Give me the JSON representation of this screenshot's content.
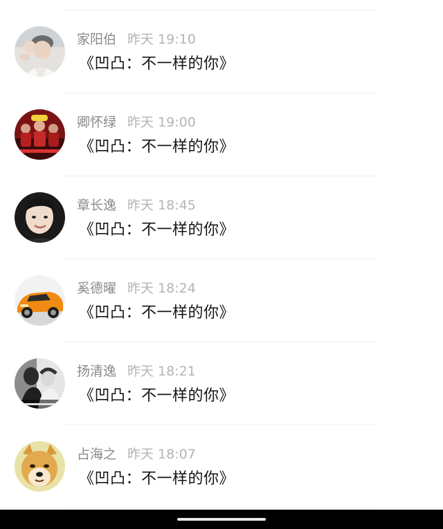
{
  "messages": [
    {
      "name": "家阳伯",
      "time": "昨天 19:10",
      "text": "《凹凸：不一样的你》",
      "avatar_icon": "young-man-photo"
    },
    {
      "name": "卿怀绿",
      "time": "昨天 19:00",
      "text": "《凹凸：不一样的你》",
      "avatar_icon": "group-poster"
    },
    {
      "name": "章长逸",
      "time": "昨天 18:45",
      "text": "《凹凸：不一样的你》",
      "avatar_icon": "smiling-boy-photo"
    },
    {
      "name": "奚德曜",
      "time": "昨天 18:24",
      "text": "《凹凸：不一样的你》",
      "avatar_icon": "orange-sports-car"
    },
    {
      "name": "扬清逸",
      "time": "昨天 18:21",
      "text": "《凹凸：不一样的你》",
      "avatar_icon": "couple-photo"
    },
    {
      "name": "占海之",
      "time": "昨天 18:07",
      "text": "《凹凸：不一样的你》",
      "avatar_icon": "doge-dog"
    }
  ],
  "colors": {
    "name": "#8a8a8a",
    "time": "#b4b4b4",
    "message": "#141414",
    "divider": "#efefef",
    "navbar": "#000000"
  }
}
